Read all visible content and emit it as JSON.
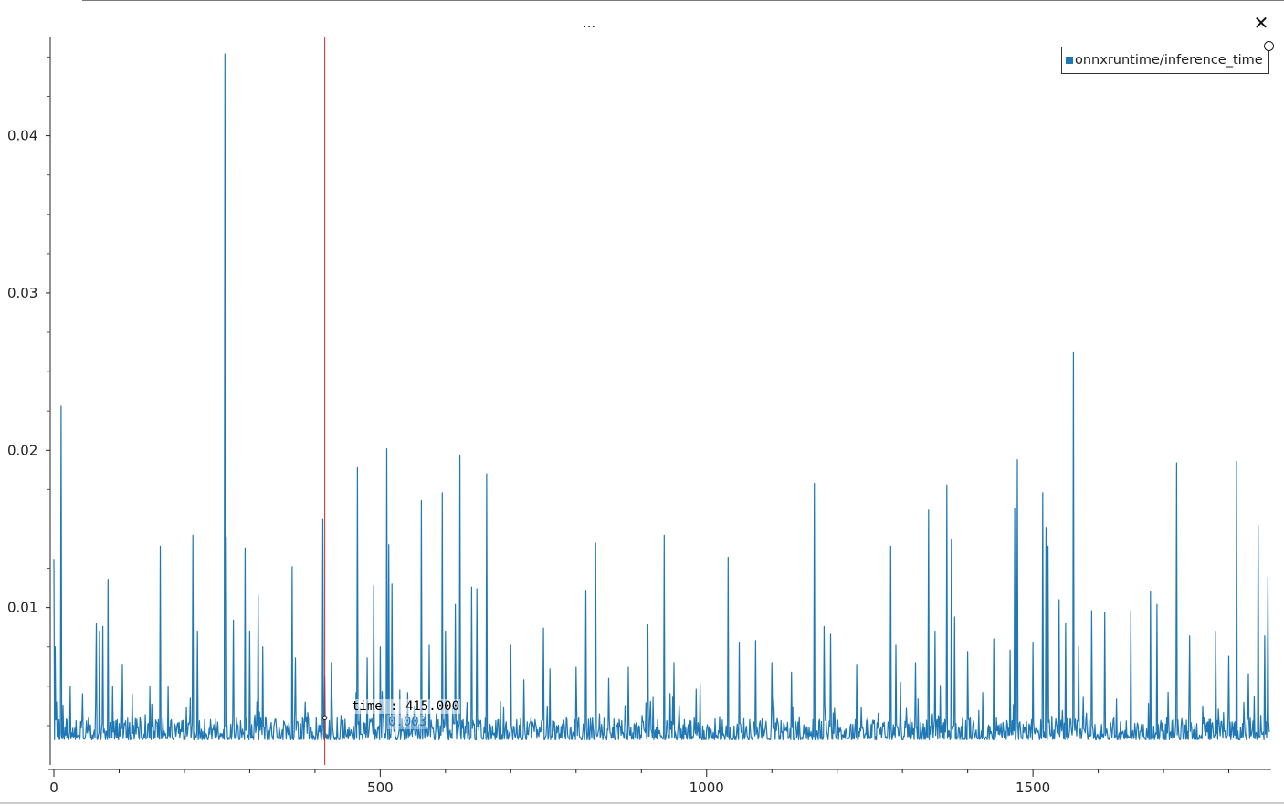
{
  "window": {
    "title": "...",
    "close_label": "✕",
    "close_icon": "close-icon"
  },
  "legend": {
    "label": "onnxruntime/inference_time",
    "color": "#1f77b4"
  },
  "tooltip": {
    "time_line": "time : 415.000",
    "value_line": "0.003"
  },
  "cursor": {
    "x": 415,
    "color": "#d62728"
  },
  "chart_data": {
    "type": "line",
    "series": [
      {
        "name": "onnxruntime/inference_time",
        "color": "#1f77b4",
        "baseline": 0.0021,
        "spikes": [
          [
            0,
            0.0131
          ],
          [
            2,
            0.0075
          ],
          [
            4,
            0.004
          ],
          [
            11,
            0.0228
          ],
          [
            14,
            0.0038
          ],
          [
            25,
            0.005
          ],
          [
            65,
            0.009
          ],
          [
            70,
            0.0085
          ],
          [
            75,
            0.0088
          ],
          [
            83,
            0.0118
          ],
          [
            90,
            0.005
          ],
          [
            105,
            0.0064
          ],
          [
            120,
            0.0045
          ],
          [
            140,
            0.0032
          ],
          [
            163,
            0.0139
          ],
          [
            175,
            0.005
          ],
          [
            213,
            0.0146
          ],
          [
            220,
            0.0085
          ],
          [
            262,
            0.0452
          ],
          [
            264,
            0.0145
          ],
          [
            275,
            0.0092
          ],
          [
            293,
            0.0138
          ],
          [
            300,
            0.0085
          ],
          [
            313,
            0.0108
          ],
          [
            320,
            0.0075
          ],
          [
            365,
            0.0126
          ],
          [
            370,
            0.0068
          ],
          [
            385,
            0.004
          ],
          [
            412,
            0.0156
          ],
          [
            415,
            0.0056
          ],
          [
            425,
            0.0065
          ],
          [
            465,
            0.0189
          ],
          [
            480,
            0.0068
          ],
          [
            490,
            0.0114
          ],
          [
            500,
            0.0075
          ],
          [
            510,
            0.0201
          ],
          [
            513,
            0.014
          ],
          [
            518,
            0.0115
          ],
          [
            563,
            0.0168
          ],
          [
            575,
            0.0076
          ],
          [
            595,
            0.0173
          ],
          [
            600,
            0.0085
          ],
          [
            615,
            0.0102
          ],
          [
            622,
            0.0197
          ],
          [
            640,
            0.0113
          ],
          [
            648,
            0.0112
          ],
          [
            663,
            0.0185
          ],
          [
            700,
            0.0076
          ],
          [
            720,
            0.0054
          ],
          [
            750,
            0.0087
          ],
          [
            760,
            0.0061
          ],
          [
            800,
            0.0062
          ],
          [
            815,
            0.0111
          ],
          [
            830,
            0.0141
          ],
          [
            850,
            0.0055
          ],
          [
            880,
            0.0062
          ],
          [
            910,
            0.0089
          ],
          [
            935,
            0.0146
          ],
          [
            950,
            0.0065
          ],
          [
            990,
            0.0052
          ],
          [
            1033,
            0.0132
          ],
          [
            1050,
            0.0078
          ],
          [
            1075,
            0.0079
          ],
          [
            1100,
            0.0065
          ],
          [
            1130,
            0.0059
          ],
          [
            1165,
            0.0179
          ],
          [
            1180,
            0.0088
          ],
          [
            1190,
            0.0083
          ],
          [
            1230,
            0.0064
          ],
          [
            1282,
            0.0139
          ],
          [
            1290,
            0.0076
          ],
          [
            1320,
            0.0065
          ],
          [
            1340,
            0.0162
          ],
          [
            1350,
            0.0085
          ],
          [
            1368,
            0.0178
          ],
          [
            1375,
            0.0143
          ],
          [
            1380,
            0.0094
          ],
          [
            1400,
            0.0072
          ],
          [
            1423,
            0.0046
          ],
          [
            1440,
            0.008
          ],
          [
            1465,
            0.0073
          ],
          [
            1472,
            0.0163
          ],
          [
            1476,
            0.0194
          ],
          [
            1500,
            0.0078
          ],
          [
            1515,
            0.0173
          ],
          [
            1520,
            0.0151
          ],
          [
            1523,
            0.0139
          ],
          [
            1540,
            0.0105
          ],
          [
            1550,
            0.009
          ],
          [
            1562,
            0.0262
          ],
          [
            1570,
            0.0075
          ],
          [
            1590,
            0.0098
          ],
          [
            1610,
            0.0097
          ],
          [
            1650,
            0.0098
          ],
          [
            1680,
            0.011
          ],
          [
            1690,
            0.0102
          ],
          [
            1720,
            0.0192
          ],
          [
            1740,
            0.0082
          ],
          [
            1780,
            0.0085
          ],
          [
            1800,
            0.0069
          ],
          [
            1812,
            0.0193
          ],
          [
            1830,
            0.0058
          ],
          [
            1845,
            0.0152
          ],
          [
            1855,
            0.0082
          ],
          [
            1860,
            0.0119
          ]
        ]
      }
    ],
    "x_ticks": [
      0,
      500,
      1000,
      1500
    ],
    "y_ticks": [
      0.01,
      0.02,
      0.03,
      0.04
    ],
    "y_tick_labels": [
      "0.01",
      "0.02",
      "0.03",
      "0.04"
    ],
    "xlim": [
      0,
      1865
    ],
    "ylim": [
      0.0,
      0.0463
    ],
    "legend": "top-right",
    "grid": false
  }
}
